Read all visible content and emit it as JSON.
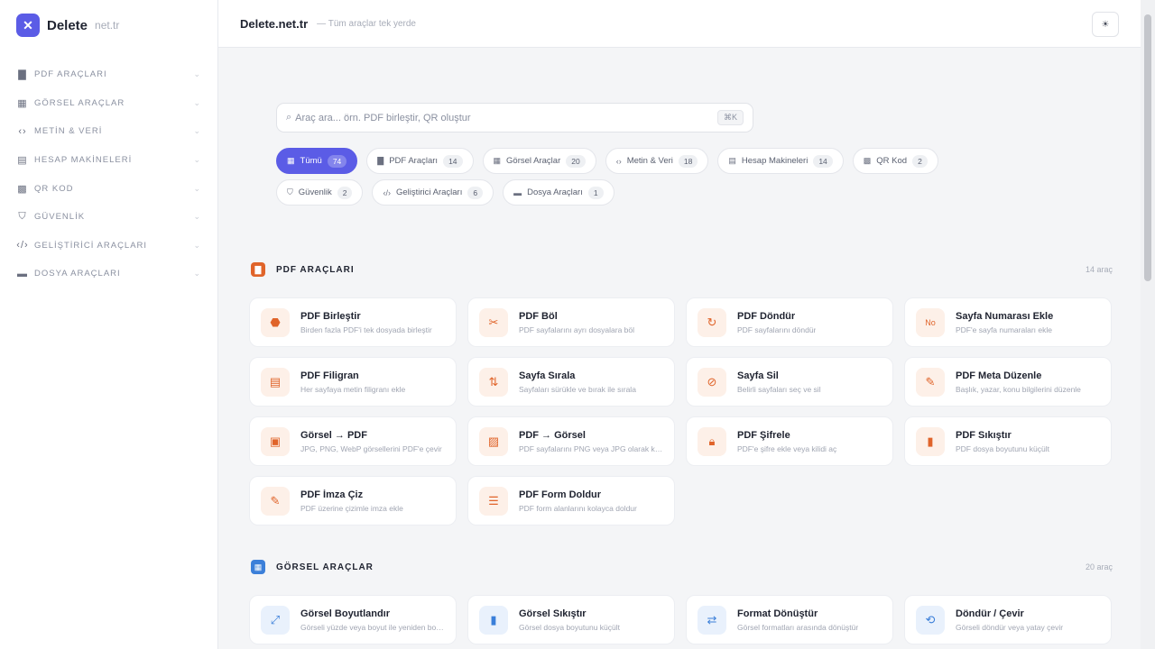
{
  "brand": {
    "name": "Delete",
    "domain": "net.tr"
  },
  "sidebar": {
    "items": [
      {
        "label": "PDF ARAÇLARI",
        "icon": "pdf-icon"
      },
      {
        "label": "GÖRSEL ARAÇLAR",
        "icon": "image-icon"
      },
      {
        "label": "METİN & VERİ",
        "icon": "code-icon"
      },
      {
        "label": "HESAP MAKİNELERİ",
        "icon": "calculator-icon"
      },
      {
        "label": "QR KOD",
        "icon": "qr-icon"
      },
      {
        "label": "GÜVENLİK",
        "icon": "shield-icon"
      },
      {
        "label": "GELİŞTİRİCİ ARAÇLARI",
        "icon": "code-icon"
      },
      {
        "label": "DOSYA ARAÇLARI",
        "icon": "folder-icon"
      }
    ]
  },
  "header": {
    "title": "Delete.net.tr",
    "subtitle": "— Tüm araçlar tek yerde"
  },
  "search": {
    "placeholder": "Araç ara... örn. PDF birleştir, QR oluştur",
    "shortcut": "⌘K"
  },
  "filters": [
    {
      "label": "Tümü",
      "count": "74",
      "active": true,
      "icon": "grid-icon"
    },
    {
      "label": "PDF Araçları",
      "count": "14",
      "icon": "pdf-icon"
    },
    {
      "label": "Görsel Araçlar",
      "count": "20",
      "icon": "image-icon"
    },
    {
      "label": "Metin & Veri",
      "count": "18",
      "icon": "code-icon"
    },
    {
      "label": "Hesap Makineleri",
      "count": "14",
      "icon": "calculator-icon"
    },
    {
      "label": "QR Kod",
      "count": "2",
      "icon": "qr-icon"
    },
    {
      "label": "Güvenlik",
      "count": "2",
      "icon": "shield-icon"
    },
    {
      "label": "Geliştirici Araçları",
      "count": "6",
      "icon": "code-icon"
    },
    {
      "label": "Dosya Araçları",
      "count": "1",
      "icon": "folder-icon"
    }
  ],
  "sections": {
    "pdf": {
      "title": "PDF ARAÇLARI",
      "count": "14 araç",
      "cards": [
        {
          "title": "PDF Birleştir",
          "desc": "Birden fazla PDF'i tek dosyada birleştir",
          "icon": "merge-icon"
        },
        {
          "title": "PDF Böl",
          "desc": "PDF sayfalarını ayrı dosyalara böl",
          "icon": "scissors-icon"
        },
        {
          "title": "PDF Döndür",
          "desc": "PDF sayfalarını döndür",
          "icon": "rotate-icon"
        },
        {
          "title": "Sayfa Numarası Ekle",
          "desc": "PDF'e sayfa numaraları ekle",
          "icon": "number-icon"
        },
        {
          "title": "PDF Filigran",
          "desc": "Her sayfaya metin filigranı ekle",
          "icon": "watermark-icon"
        },
        {
          "title": "Sayfa Sırala",
          "desc": "Sayfaları sürükle ve bırak ile sırala",
          "icon": "sort-icon"
        },
        {
          "title": "Sayfa Sil",
          "desc": "Belirli sayfaları seç ve sil",
          "icon": "delete-page-icon"
        },
        {
          "title": "PDF Meta Düzenle",
          "desc": "Başlık, yazar, konu bilgilerini düzenle",
          "icon": "edit-icon"
        },
        {
          "title": "Görsel → PDF",
          "desc": "JPG, PNG, WebP görsellerini PDF'e çevir",
          "icon": "image-to-pdf-icon"
        },
        {
          "title": "PDF → Görsel",
          "desc": "PDF sayfalarını PNG veya JPG olarak kaydet",
          "icon": "pdf-to-image-icon"
        },
        {
          "title": "PDF Şifrele",
          "desc": "PDF'e şifre ekle veya kilidi aç",
          "icon": "lock-icon"
        },
        {
          "title": "PDF Sıkıştır",
          "desc": "PDF dosya boyutunu küçült",
          "icon": "compress-icon"
        },
        {
          "title": "PDF İmza Çiz",
          "desc": "PDF üzerine çizimle imza ekle",
          "icon": "pen-icon"
        },
        {
          "title": "PDF Form Doldur",
          "desc": "PDF form alanlarını kolayca doldur",
          "icon": "form-icon"
        }
      ]
    },
    "img": {
      "title": "GÖRSEL ARAÇLAR",
      "count": "20 araç",
      "cards": [
        {
          "title": "Görsel Boyutlandır",
          "desc": "Görseli yüzde veya boyut ile yeniden boyutlandır",
          "icon": "resize-icon"
        },
        {
          "title": "Görsel Sıkıştır",
          "desc": "Görsel dosya boyutunu küçült",
          "icon": "compress-icon"
        },
        {
          "title": "Format Dönüştür",
          "desc": "Görsel formatları arasında dönüştür",
          "icon": "convert-icon"
        },
        {
          "title": "Döndür / Çevir",
          "desc": "Görseli döndür veya yatay çevir",
          "icon": "rotate-icon"
        }
      ]
    }
  },
  "colors": {
    "accent": "#5b5ce6",
    "pdf": "#e0642a",
    "image": "#3b7fd9"
  }
}
